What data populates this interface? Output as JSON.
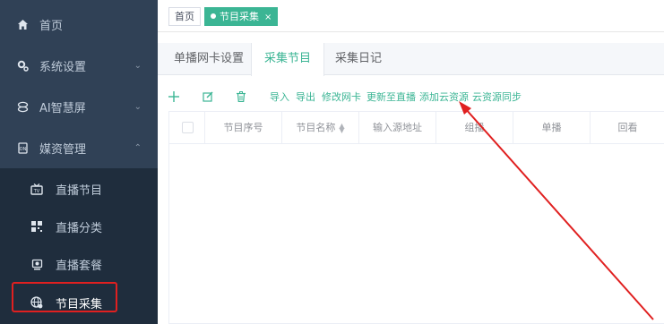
{
  "sidebar": {
    "items": [
      {
        "label": "首页",
        "icon": "home-icon"
      },
      {
        "label": "系统设置",
        "icon": "gear-icon"
      },
      {
        "label": "AI智慧屏",
        "icon": "ai-icon"
      },
      {
        "label": "媒资管理",
        "icon": "media-icon"
      }
    ],
    "subitems": [
      {
        "label": "直播节目",
        "icon": "tv-icon"
      },
      {
        "label": "直播分类",
        "icon": "category-icon"
      },
      {
        "label": "直播套餐",
        "icon": "package-icon"
      },
      {
        "label": "节目采集",
        "icon": "globe-icon"
      }
    ]
  },
  "tags": {
    "home": "首页",
    "active": "节目采集",
    "close": "×"
  },
  "tabs": [
    "单播网卡设置",
    "采集节目",
    "采集日记"
  ],
  "toolbar": {
    "links": [
      "导入",
      "导出",
      "修改网卡",
      "更新至直播",
      "添加云资源",
      "云资源同步"
    ]
  },
  "table": {
    "headers": [
      "节目序号",
      "节目名称",
      "输入源地址",
      "组播",
      "单播",
      "回看"
    ]
  },
  "colors": {
    "sidebar_bg": "#304156",
    "accent": "#3bb594",
    "annotation": "#e02020"
  }
}
